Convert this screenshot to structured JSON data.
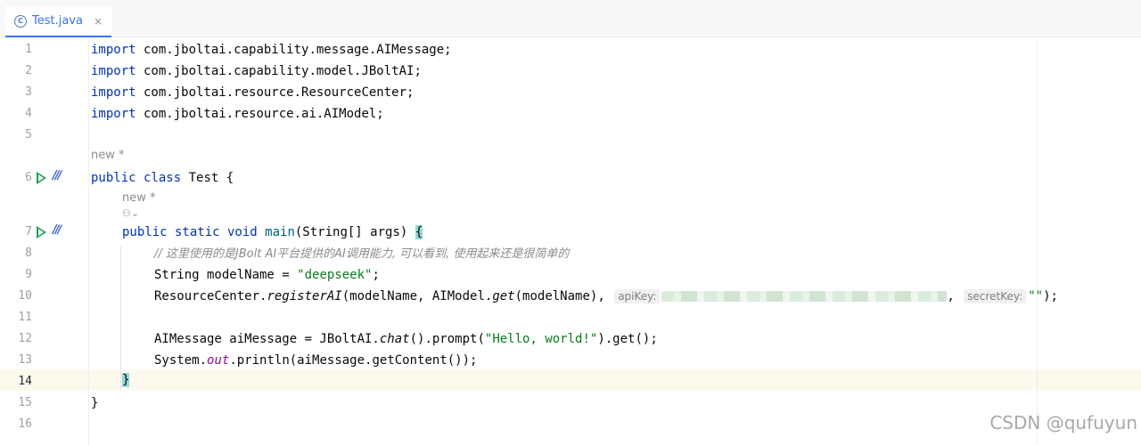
{
  "tab": {
    "label": "Test.java",
    "icon": "java-class-icon",
    "close": "×"
  },
  "lines": [
    {
      "n": "1"
    },
    {
      "n": "2"
    },
    {
      "n": "3"
    },
    {
      "n": "4"
    },
    {
      "n": "5"
    },
    {
      "n": "6"
    },
    {
      "n": "7"
    },
    {
      "n": "8"
    },
    {
      "n": "9"
    },
    {
      "n": "10"
    },
    {
      "n": "11"
    },
    {
      "n": "12"
    },
    {
      "n": "13"
    },
    {
      "n": "14"
    },
    {
      "n": "15"
    },
    {
      "n": "16"
    }
  ],
  "code": {
    "kw_import": "import",
    "l1": " com.jboltai.capability.message.AIMessage;",
    "l2": " com.jboltai.capability.model.JBoltAI;",
    "l3": " com.jboltai.resource.ResourceCenter;",
    "l4": " com.jboltai.resource.ai.AIModel;",
    "l6_kw": "public class",
    "l6_rest": " Test {",
    "l7_kw1": "public static void",
    "l7_fn": "main",
    "l7_rest": "(String[] args) ",
    "l7_brace": "{",
    "l8_comment": "// 这里使用的是JBolt AI平台提供的AI调用能力, 可以看到, 使用起来还是很简单的",
    "l9_a": "String modelName = ",
    "l9_str": "\"deepseek\"",
    "l9_b": ";",
    "l10_a": "ResourceCenter.",
    "l10_fn1": "registerAI",
    "l10_b": "(modelName, AIModel.",
    "l10_fn2": "get",
    "l10_c": "(modelName), ",
    "l10_hint1": "apiKey:",
    "l10_d": ", ",
    "l10_hint2": "secretKey:",
    "l10_str": "\"\"",
    "l10_e": ");",
    "l12_a": "AIMessage aiMessage = JBoltAI.",
    "l12_fn": "chat",
    "l12_b": "().prompt(",
    "l12_str": "\"Hello, world!\"",
    "l12_c": ").get();",
    "l13_a": "System.",
    "l13_static": "out",
    "l13_b": ".println(aiMessage.getContent());",
    "l14": "}",
    "l15": "}"
  },
  "inlays": {
    "new1": "new *",
    "new2": "new *",
    "author_icon": "user-icon"
  },
  "watermark": "CSDN @qufuyun"
}
